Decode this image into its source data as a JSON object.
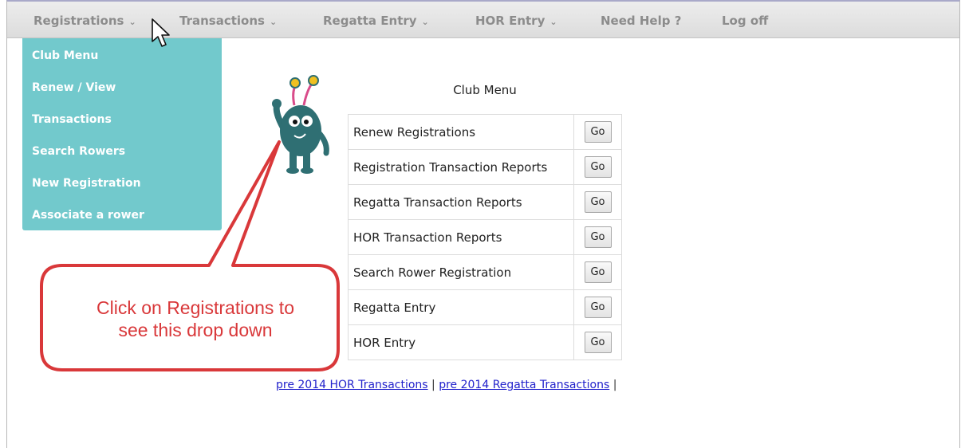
{
  "nav": {
    "items": [
      {
        "label": "Registrations",
        "chevron": true
      },
      {
        "label": "Transactions",
        "chevron": true
      },
      {
        "label": "Regatta Entry",
        "chevron": true
      },
      {
        "label": "HOR Entry",
        "chevron": true
      },
      {
        "label": "Need Help ?",
        "chevron": false
      },
      {
        "label": "Log off",
        "chevron": false
      }
    ]
  },
  "dropdown": {
    "items": [
      {
        "label": "Club Menu"
      },
      {
        "label": "Renew / View"
      },
      {
        "label": "Transactions"
      },
      {
        "label": "Search Rowers"
      },
      {
        "label": "New Registration"
      },
      {
        "label": "Associate a rower"
      }
    ],
    "color": "#72c9cc"
  },
  "club_menu": {
    "title": "Club Menu",
    "button_label": "Go",
    "rows": [
      {
        "label": "Renew Registrations"
      },
      {
        "label": "Registration Transaction Reports"
      },
      {
        "label": "Regatta Transaction Reports"
      },
      {
        "label": "HOR Transaction Reports"
      },
      {
        "label": "Search Rower Registration"
      },
      {
        "label": "Regatta Entry"
      },
      {
        "label": "HOR Entry"
      }
    ]
  },
  "footer_links": {
    "hor": "pre 2014 HOR Transactions",
    "sep1": "|",
    "regatta": "pre 2014 Regatta Transactions",
    "sep2": "|"
  },
  "callout": {
    "line1": "Click on Registrations to",
    "line2": "see this drop down",
    "color": "#d9383a"
  },
  "mascot": {
    "icon": "monster-mascot-icon",
    "color": "#2f6f73"
  }
}
